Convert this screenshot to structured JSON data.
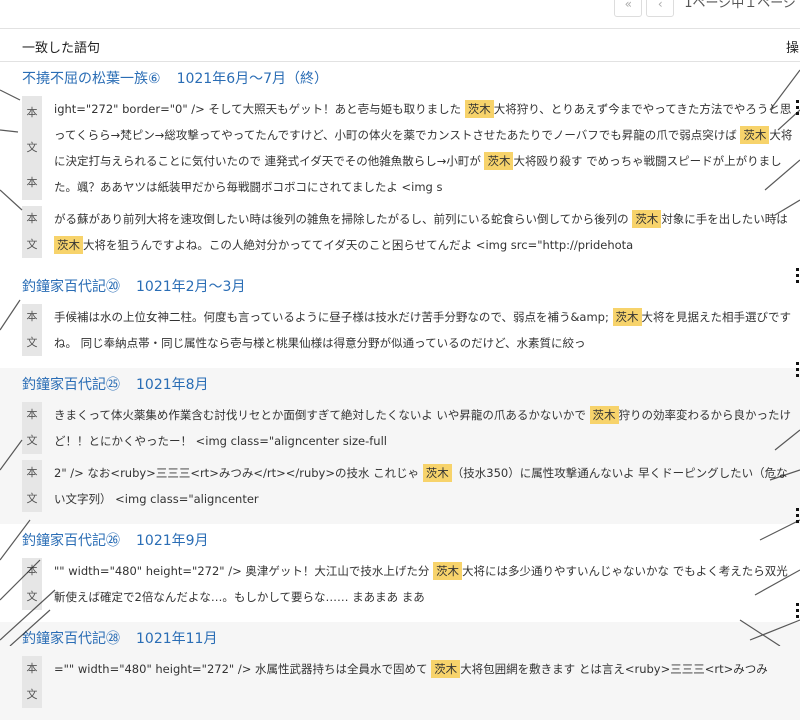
{
  "pager": {
    "first": "«",
    "prev": "‹",
    "status": "1ページ中１ページ"
  },
  "header": {
    "col_match": "一致した語句",
    "col_action": "操"
  },
  "label_chars": [
    "本",
    "文"
  ],
  "items": [
    {
      "title": "不撓不屈の松葉一族⑥",
      "period": "1021年6月〜7月（終）",
      "snippets": [
        {
          "before": "ight=\"272\" border=\"0\" /> そして大照天もゲット！あと壱与姫も取りました ",
          "kw": "茨木",
          "after": "大将狩り、とりあえず今までやってきた方法でやろうと思ってくらら→梵ピン→総攻撃ってやってたんですけど、小町の体火を薬でカンストさせたあたりでノーバフでも昇龍の爪で弱点突けば ",
          "kw2": "茨木",
          "after2": "大将に決定打与えられることに気付いたので 連発式イダ天でその他雑魚散らし→小町が ",
          "kw3": "茨木",
          "after3": "大将殴り殺す でめっちゃ戦闘スピードが上がりました。颯？ああヤツは紙装甲だから毎戦闘ボコボコにされてましたよ <img s"
        },
        {
          "before": "がる蘇があり前列大将を速攻倒したい時は後列の雑魚を掃除したがるし、前列にいる蛇食らい倒してから後列の ",
          "kw": "茨木",
          "after": "対象に手を出したい時は ",
          "kw2": "茨木",
          "after2": "大将を狙うんですよね。この人絶対分かっててイダ天のこと困らせてんだよ <img src=\"http://pridehota",
          "kw3": "",
          "after3": ""
        }
      ]
    },
    {
      "title": "釣鐘家百代記⑳",
      "period": "1021年2月〜3月",
      "snippets": [
        {
          "before": "手候補は水の上位女神二柱。何度も言っているように昼子様は技水だけ苦手分野なので、弱点を補う&amp; ",
          "kw": "茨木",
          "after": "大将を見据えた相手選びですね。 同じ奉納点帯・同じ属性なら壱与様と桃果仙様は得意分野が似通っているのだけど、水素質に絞っ",
          "kw2": "",
          "after2": "",
          "kw3": "",
          "after3": ""
        }
      ]
    },
    {
      "title": "釣鐘家百代記㉕",
      "period": "1021年8月",
      "snippets": [
        {
          "before": "きまくって体火薬集め作業含む討伐リセとか面倒すぎて絶対したくないよ いや昇龍の爪あるかないかで ",
          "kw": "茨木",
          "after": "狩りの効率変わるから良かったけど！！とにかくやったー！ <img class=\"aligncenter size-full",
          "kw2": "",
          "after2": "",
          "kw3": "",
          "after3": ""
        },
        {
          "before": "2\" /> なお<ruby>三三三<rt>みつみ</rt></ruby>の技水 これじゃ ",
          "kw": "茨木",
          "after": "（技水350）に属性攻撃通んないよ 早くドーピングしたい（危ない文字列） <img class=\"aligncenter",
          "kw2": "",
          "after2": "",
          "kw3": "",
          "after3": ""
        }
      ]
    },
    {
      "title": "釣鐘家百代記㉖",
      "period": "1021年9月",
      "snippets": [
        {
          "before": "\"\" width=\"480\" height=\"272\" /> 奥津ゲット！大江山で技水上げた分 ",
          "kw": "茨木",
          "after": "大将には多少通りやすいんじゃないかな でもよく考えたら双光斬使えば確定で2倍なんだよな…。もしかして要らな…… まあまあ まあ",
          "kw2": "",
          "after2": "",
          "kw3": "",
          "after3": ""
        }
      ]
    },
    {
      "title": "釣鐘家百代記㉘",
      "period": "1021年11月",
      "snippets": [
        {
          "before": "=\"\" width=\"480\" height=\"272\" /> 水属性武器持ちは全員水で固めて ",
          "kw": "茨木",
          "after": "大将包囲網を敷きます とは言え<ruby>三三三<rt>みつみ",
          "kw2": "",
          "after2": "",
          "kw3": "",
          "after3": ""
        }
      ]
    }
  ]
}
